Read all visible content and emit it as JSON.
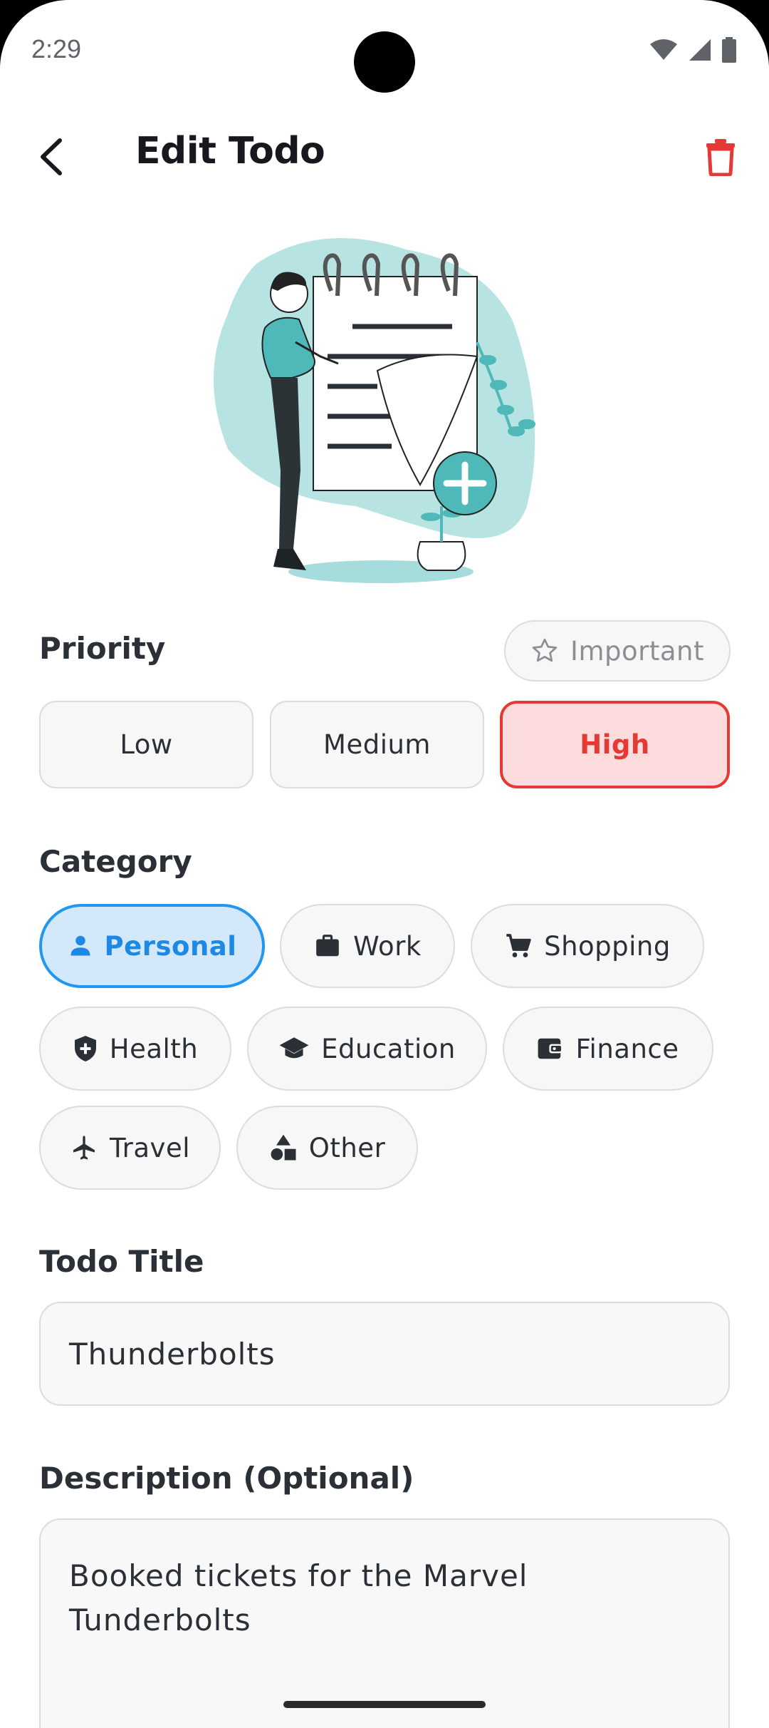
{
  "status_bar": {
    "time": "2:29"
  },
  "app_bar": {
    "title": "Edit Todo"
  },
  "priority": {
    "label": "Priority",
    "important_label": "Important",
    "options": [
      "Low",
      "Medium",
      "High"
    ],
    "selected": "High"
  },
  "category": {
    "label": "Category",
    "options": [
      {
        "label": "Personal",
        "icon": "person-icon"
      },
      {
        "label": "Work",
        "icon": "briefcase-icon"
      },
      {
        "label": "Shopping",
        "icon": "cart-icon"
      },
      {
        "label": "Health",
        "icon": "shield-plus-icon"
      },
      {
        "label": "Education",
        "icon": "graduation-cap-icon"
      },
      {
        "label": "Finance",
        "icon": "wallet-icon"
      },
      {
        "label": "Travel",
        "icon": "airplane-icon"
      },
      {
        "label": "Other",
        "icon": "shapes-icon"
      }
    ],
    "selected": "Personal"
  },
  "todo_title": {
    "label": "Todo Title",
    "value": "Thunderbolts"
  },
  "description": {
    "label": "Description (Optional)",
    "value": "Booked tickets for the Marvel Tunderbolts"
  },
  "colors": {
    "accent_red": "#e53935",
    "accent_blue": "#1e88e5",
    "illustration_teal": "#4fb8b8"
  }
}
